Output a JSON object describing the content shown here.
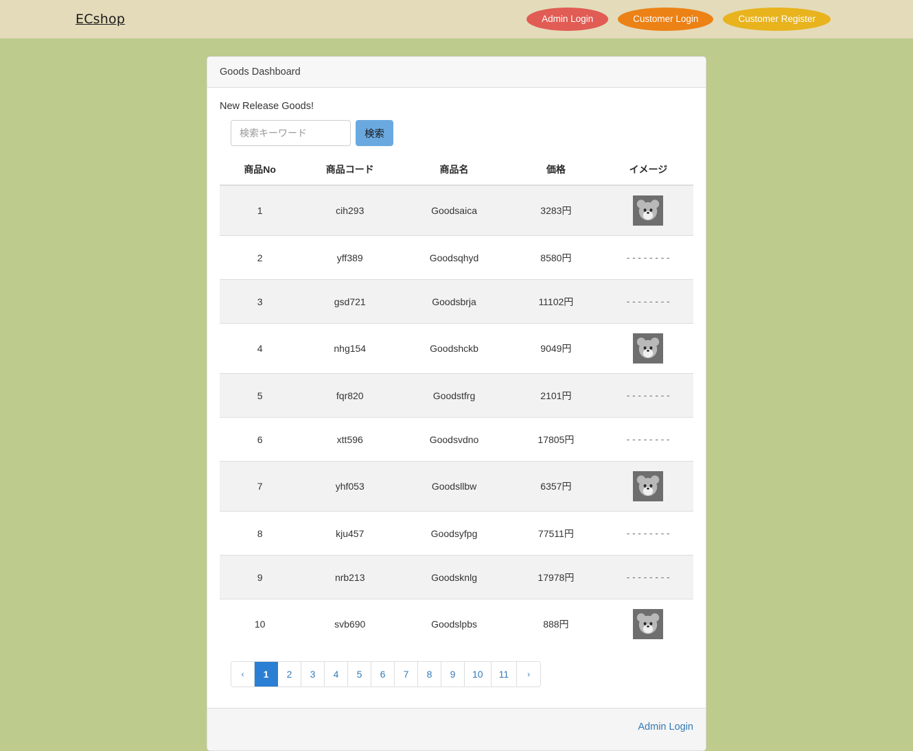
{
  "navbar": {
    "brand": "ECshop",
    "buttons": [
      {
        "label": "Admin Login",
        "color": "#e05c54",
        "name": "admin-login"
      },
      {
        "label": "Customer Login",
        "color": "#ec8115",
        "name": "customer-login"
      },
      {
        "label": "Customer Register",
        "color": "#e8b31d",
        "name": "customer-register"
      }
    ]
  },
  "card": {
    "header_title": "Goods Dashboard",
    "lead": "New Release Goods!",
    "search": {
      "placeholder": "検索キーワード",
      "value": "",
      "button_label": "検索"
    },
    "footer_link": "Admin Login"
  },
  "table": {
    "columns": [
      "商品No",
      "商品コード",
      "商品名",
      "価格",
      "イメージ"
    ],
    "no_image_text": "--------",
    "rows": [
      {
        "no": "1",
        "code": "cih293",
        "name": "Goodsaica",
        "price": "3283円",
        "image": "thumb"
      },
      {
        "no": "2",
        "code": "yff389",
        "name": "Goodsqhyd",
        "price": "8580円",
        "image": "none"
      },
      {
        "no": "3",
        "code": "gsd721",
        "name": "Goodsbrja",
        "price": "11102円",
        "image": "none"
      },
      {
        "no": "4",
        "code": "nhg154",
        "name": "Goodshckb",
        "price": "9049円",
        "image": "thumb"
      },
      {
        "no": "5",
        "code": "fqr820",
        "name": "Goodstfrg",
        "price": "2101円",
        "image": "none"
      },
      {
        "no": "6",
        "code": "xtt596",
        "name": "Goodsvdno",
        "price": "17805円",
        "image": "none"
      },
      {
        "no": "7",
        "code": "yhf053",
        "name": "Goodsllbw",
        "price": "6357円",
        "image": "thumb"
      },
      {
        "no": "8",
        "code": "kju457",
        "name": "Goodsyfpg",
        "price": "77511円",
        "image": "none"
      },
      {
        "no": "9",
        "code": "nrb213",
        "name": "Goodsknlg",
        "price": "17978円",
        "image": "none"
      },
      {
        "no": "10",
        "code": "svb690",
        "name": "Goodslpbs",
        "price": "888円",
        "image": "thumb"
      }
    ]
  },
  "pagination": {
    "prev_label": "‹",
    "next_label": "›",
    "pages": [
      "1",
      "2",
      "3",
      "4",
      "5",
      "6",
      "7",
      "8",
      "9",
      "10",
      "11"
    ],
    "active": "1"
  },
  "colors": {
    "navbar_bg": "#e4dbba",
    "page_bg": "#bdcb8d",
    "link": "#337ab7",
    "active_page": "#2a7fd4",
    "search_button": "#6aa9e0"
  }
}
